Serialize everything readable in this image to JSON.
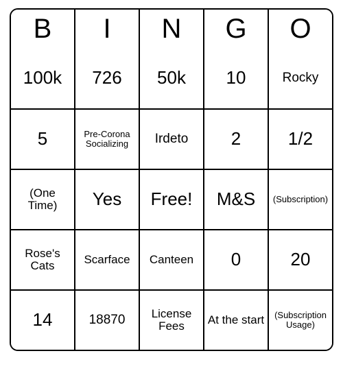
{
  "header": [
    "B",
    "I",
    "N",
    "G",
    "O"
  ],
  "grid": [
    [
      {
        "text": "100k",
        "size": ""
      },
      {
        "text": "726",
        "size": ""
      },
      {
        "text": "50k",
        "size": ""
      },
      {
        "text": "10",
        "size": ""
      },
      {
        "text": "Rocky",
        "size": "med2"
      }
    ],
    [
      {
        "text": "5",
        "size": ""
      },
      {
        "text": "Pre-Corona Socializing",
        "size": "small"
      },
      {
        "text": "Irdeto",
        "size": "med2"
      },
      {
        "text": "2",
        "size": ""
      },
      {
        "text": "1/2",
        "size": ""
      }
    ],
    [
      {
        "text": "(One Time)",
        "size": "med"
      },
      {
        "text": "Yes",
        "size": ""
      },
      {
        "text": "Free!",
        "size": ""
      },
      {
        "text": "M&S",
        "size": ""
      },
      {
        "text": "(Subscription)",
        "size": "small"
      }
    ],
    [
      {
        "text": "Rose's Cats",
        "size": "med"
      },
      {
        "text": "Scarface",
        "size": "med"
      },
      {
        "text": "Canteen",
        "size": "med"
      },
      {
        "text": "0",
        "size": ""
      },
      {
        "text": "20",
        "size": ""
      }
    ],
    [
      {
        "text": "14",
        "size": ""
      },
      {
        "text": "18870",
        "size": "med2"
      },
      {
        "text": "License Fees",
        "size": "med"
      },
      {
        "text": "At the start",
        "size": "med"
      },
      {
        "text": "(Subscription Usage)",
        "size": "small"
      }
    ]
  ]
}
